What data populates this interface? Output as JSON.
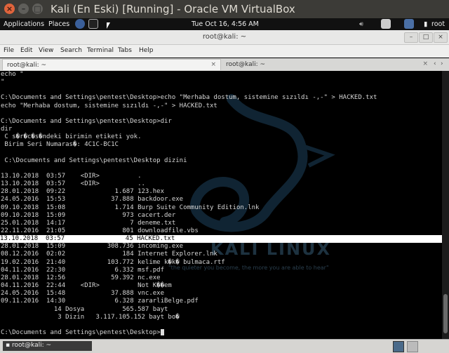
{
  "vbox": {
    "title": "Kali (En Eski) [Running] - Oracle VM VirtualBox",
    "close_glyph": "×",
    "min_glyph": "–",
    "max_glyph": "□"
  },
  "gnome": {
    "applications": "Applications",
    "places": "Places",
    "clock": "Tue Oct 16,  4:56 AM",
    "user": "root"
  },
  "terminal": {
    "title": "root@kali: ~",
    "menu": [
      "File",
      "Edit",
      "View",
      "Search",
      "Terminal",
      "Tabs",
      "Help"
    ],
    "tabs": [
      "root@kali: ~",
      "root@kali: ~"
    ],
    "lines": [
      "echo \"",
      "\"",
      "",
      "C:\\Documents and Settings\\pentest\\Desktop>echo \"Merhaba dostum, sistemine sızıldı -,-\" > HACKED.txt",
      "echo \"Merhaba dostum, sistemine sızıldı -,-\" > HACKED.txt",
      "",
      "C:\\Documents and Settings\\pentest\\Desktop>dir",
      "dir",
      " C s�r�c�s�ndeki birimin etiketi yok.",
      " Birim Seri Numaras�: 4C1C-BC1C",
      "",
      " C:\\Documents and Settings\\pentest\\Desktop dizini",
      "",
      "13.10.2018  03:57    <DIR>          .",
      "13.10.2018  03:57    <DIR>          ..",
      "28.01.2018  09:22             1.687 123.hex",
      "24.05.2016  15:53            37.888 backdoor.exe",
      "09.10.2018  15:08             1.714 Burp Suite Community Edition.lnk",
      "09.10.2018  15:09               973 cacert.der",
      "25.01.2018  14:17                 7 deneme.txt",
      "22.11.2016  21:05               801 downloadfile.vbs",
      "13.10.2018  03:57                45 HACKED.txt",
      "28.01.2018  15:09           308.736 incoming.exe",
      "08.12.2016  02:02               184 Internet Explorer.lnk",
      "19.02.2016  21:40           103.772 kelime k�k� bulmaca.rtf",
      "04.11.2016  22:30             6.332 msf.pdf",
      "28.01.2018  12:56            59.392 nc.exe",
      "04.11.2016  22:44    <DIR>          Not K��em",
      "24.05.2016  15:48            37.888 vnc.exe",
      "09.11.2016  14:30             6.328 zararliBelge.pdf",
      "              14 Dosya          565.587 bayt",
      "               3 Dizin   3.117.105.152 bayt bo�",
      "",
      "C:\\Documents and Settings\\pentest\\Desktop>"
    ],
    "highlight_index": 21,
    "watermark": {
      "brand": "KALI LINUX",
      "quote": "\"the quieter you become, the more you are able to hear\""
    }
  },
  "bottom": {
    "task_label": "root@kali: ~"
  }
}
